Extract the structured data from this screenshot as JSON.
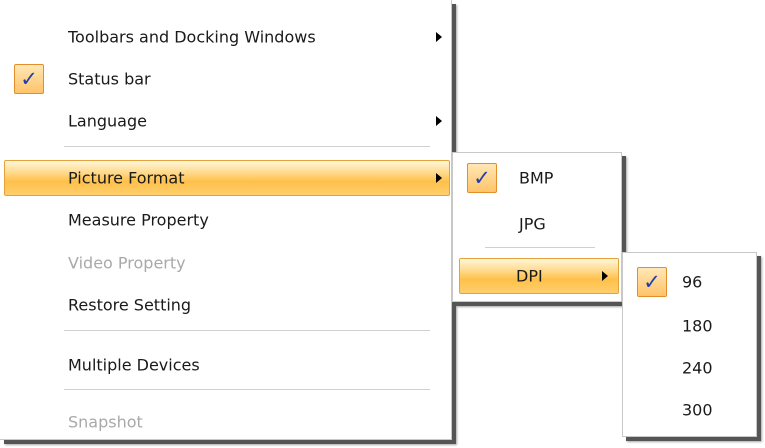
{
  "main_menu": {
    "toolbars": "Toolbars and Docking Windows",
    "status_bar": "Status bar",
    "language": "Language",
    "picture_format": "Picture Format",
    "measure_property": "Measure Property",
    "video_property": "Video Property",
    "restore_setting": "Restore Setting",
    "multiple_devices": "Multiple Devices",
    "snapshot": "Snapshot"
  },
  "check_mark": "✓",
  "picture_format_menu": {
    "bmp": "BMP",
    "jpg": "JPG",
    "dpi": "DPI"
  },
  "dpi_menu": {
    "items": [
      "96",
      "180",
      "240",
      "300"
    ],
    "selected": "96"
  },
  "colors": {
    "highlight": "#ffc04a",
    "check_mark": "#1f3fa8",
    "disabled_text": "#a9a9a9"
  }
}
